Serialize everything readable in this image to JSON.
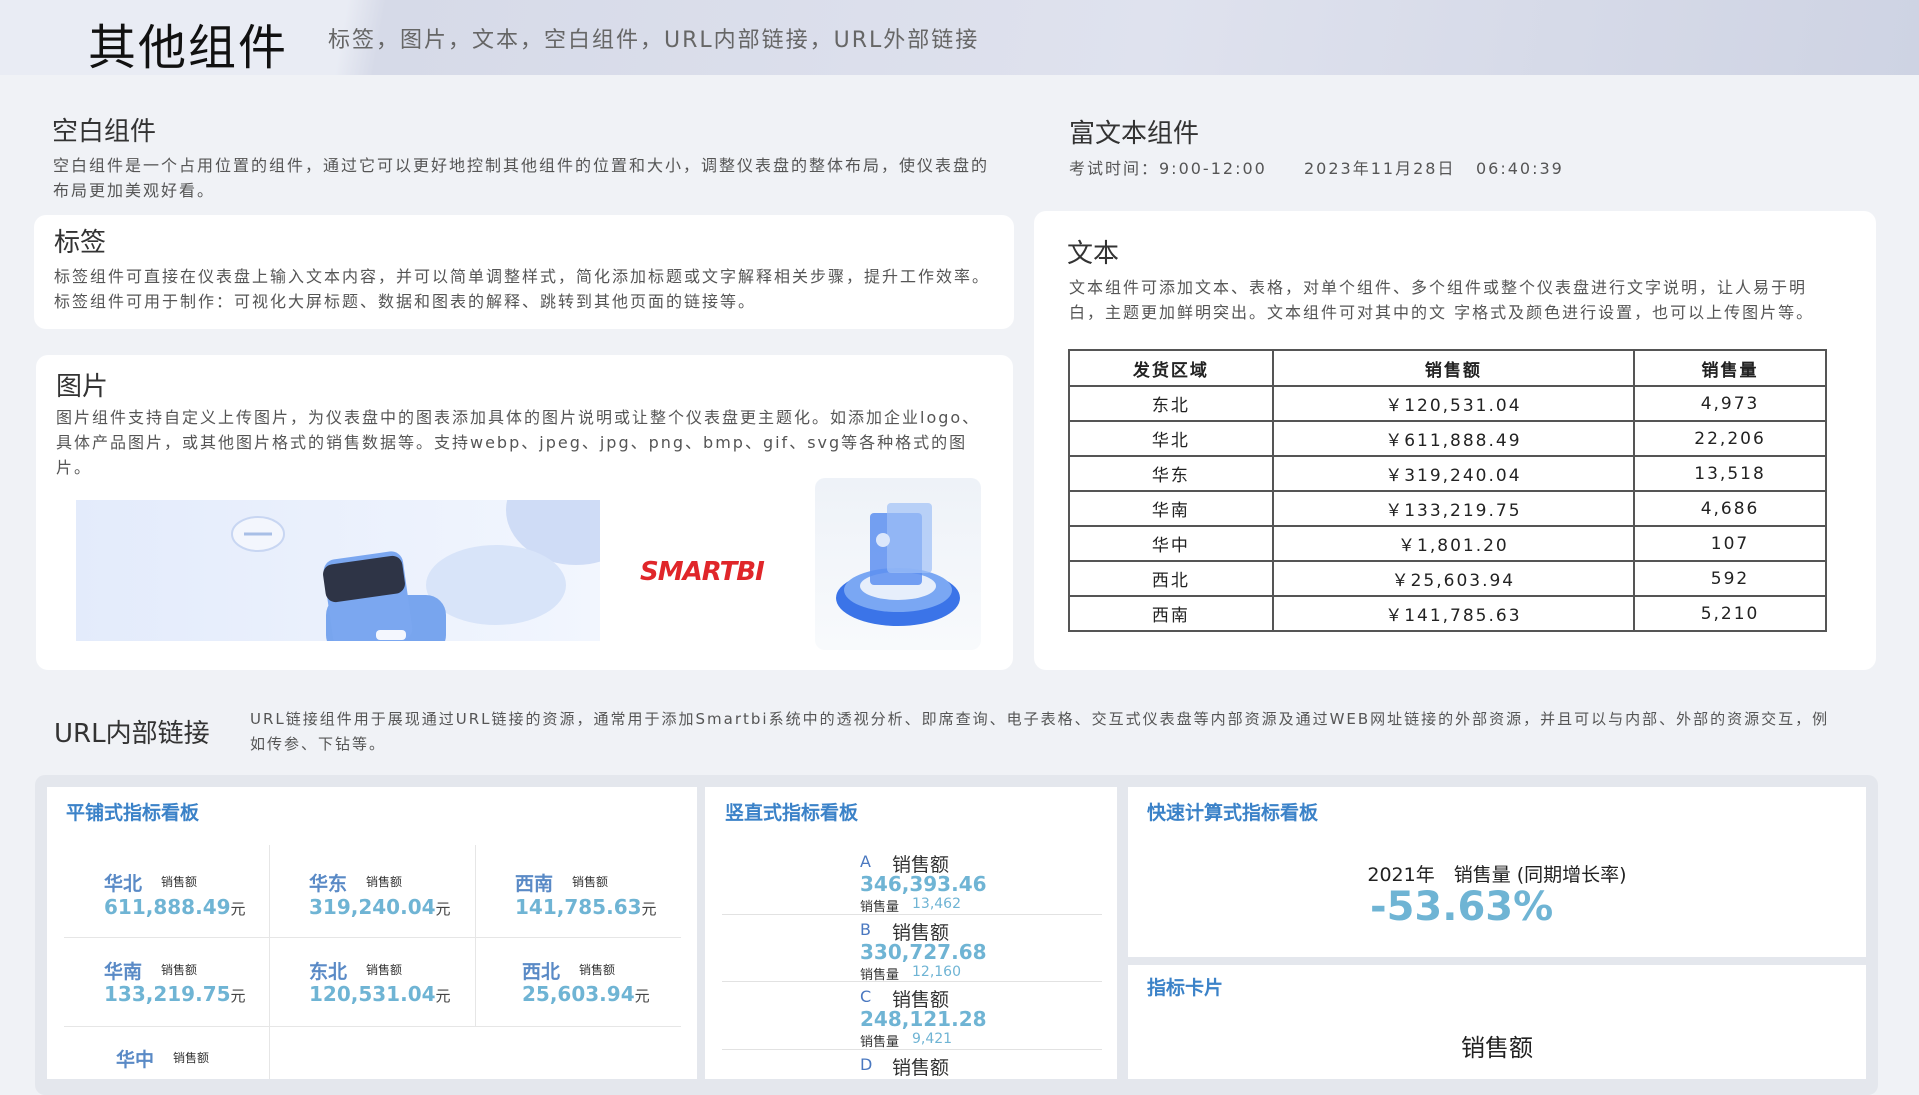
{
  "header": {
    "title": "其他组件",
    "subtitle": "标签，图片，文本，空白组件，URL内部链接，URL外部链接"
  },
  "blank": {
    "title": "空白组件",
    "desc": "空白组件是一个占用位置的组件，通过它可以更好地控制其他组件的位置和大小，调整仪表盘的整体布局，使仪表盘的布局更加美观好看。"
  },
  "label": {
    "title": "标签",
    "desc": "标签组件可直接在仪表盘上输入文本内容，并可以简单调整样式，简化添加标题或文字解释相关步骤，提升工作效率。标签组件可用于制作：可视化大屏标题、数据和图表的解释、跳转到其他页面的链接等。"
  },
  "image": {
    "title": "图片",
    "desc": "图片组件支持自定义上传图片，为仪表盘中的图表添加具体的图片说明或让整个仪表盘更主题化。如添加企业logo、具体产品图片，或其他图片格式的销售数据等。支持webp、jpeg、jpg、png、bmp、gif、svg等各种格式的图片。",
    "logo_text": "SMARTBI"
  },
  "richtext": {
    "title": "富文本组件",
    "exam_time": "考试时间：9:00-12:00",
    "date": "2023年11月28日",
    "time": "06:40:39"
  },
  "text": {
    "title": "文本",
    "desc": "文本组件可添加文本、表格，对单个组件、多个组件或整个仪表盘进行文字说明，让人易于明白，主题更加鲜明突出。文本组件可对其中的文 字格式及颜色进行设置，也可以上传图片等。",
    "table": {
      "headers": [
        "发货区域",
        "销售额",
        "销售量"
      ],
      "rows": [
        [
          "东北",
          "￥120,531.04",
          "4,973"
        ],
        [
          "华北",
          "￥611,888.49",
          "22,206"
        ],
        [
          "华东",
          "￥319,240.04",
          "13,518"
        ],
        [
          "华南",
          "￥133,219.75",
          "4,686"
        ],
        [
          "华中",
          "￥1,801.20",
          "107"
        ],
        [
          "西北",
          "￥25,603.94",
          "592"
        ],
        [
          "西南",
          "￥141,785.63",
          "5,210"
        ]
      ]
    }
  },
  "url": {
    "title": "URL内部链接",
    "desc": "URL链接组件用于展现通过URL链接的资源，通常用于添加Smartbi系统中的透视分析、即席查询、电子表格、交互式仪表盘等内部资源及通过WEB网址链接的外部资源，并且可以与内部、外部的资源交互，例如传参、下钻等。"
  },
  "tile_board": {
    "title": "平铺式指标看板",
    "metric_label": "销售额",
    "unit": "元",
    "items": [
      {
        "region": "华北",
        "value": "611,888.49"
      },
      {
        "region": "华东",
        "value": "319,240.04"
      },
      {
        "region": "西南",
        "value": "141,785.63"
      },
      {
        "region": "华南",
        "value": "133,219.75"
      },
      {
        "region": "东北",
        "value": "120,531.04"
      },
      {
        "region": "西北",
        "value": "25,603.94"
      },
      {
        "region": "华中",
        "value": ""
      }
    ]
  },
  "vertical_board": {
    "title": "竖直式指标看板",
    "label": "销售额",
    "sub_label": "销售量",
    "items": [
      {
        "letter": "A",
        "value": "346,393.46",
        "sub": "13,462"
      },
      {
        "letter": "B",
        "value": "330,727.68",
        "sub": "12,160"
      },
      {
        "letter": "C",
        "value": "248,121.28",
        "sub": "9,421"
      },
      {
        "letter": "D",
        "value": "",
        "sub": ""
      }
    ]
  },
  "quick_calc": {
    "title": "快速计算式指标看板",
    "label": "2021年　销售量 (同期增长率)",
    "value": "-53.63%"
  },
  "metric_card": {
    "title": "指标卡片",
    "label": "销售额"
  },
  "colors": {
    "accent": "#3b82c8",
    "value": "#6fb4d4",
    "region": "#5a8ac6",
    "smartbi": "#e0262a"
  }
}
